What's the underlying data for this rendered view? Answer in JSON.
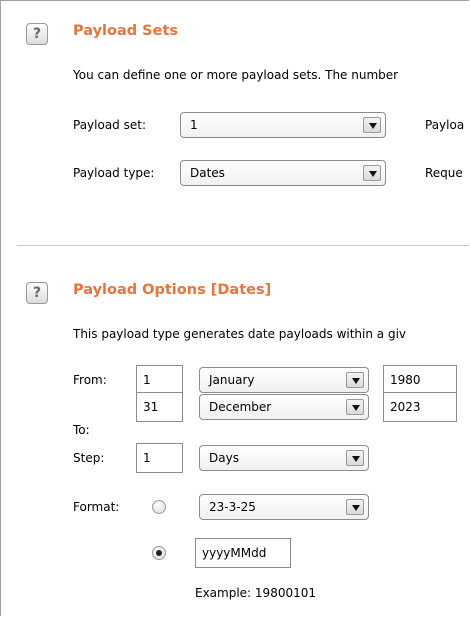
{
  "payload_sets": {
    "help_icon": "?",
    "title": "Payload Sets",
    "description": "You can define one or more payload sets. The number",
    "payload_set_label": "Payload set:",
    "payload_set_value": "1",
    "payload_count_label_partial": "Payloa",
    "payload_type_label": "Payload type:",
    "payload_type_value": "Dates",
    "request_count_label_partial": "Reque"
  },
  "payload_options": {
    "help_icon": "?",
    "title": "Payload Options [Dates]",
    "description": "This payload type generates date payloads within a giv",
    "from": {
      "label": "From:",
      "day": "1",
      "month": "January",
      "year": "1980"
    },
    "to": {
      "label": "To:",
      "day": "31",
      "month": "December",
      "year": "2023"
    },
    "step": {
      "label": "Step:",
      "amount": "1",
      "unit": "Days"
    },
    "format": {
      "label": "Format:",
      "preset_value": "23-3-25",
      "preset_selected": false,
      "custom_value": "yyyyMMdd",
      "custom_selected": true
    },
    "example": "Example:  19800101"
  },
  "icons": {
    "dropdown": "triangle-down-icon",
    "help": "help-icon"
  }
}
